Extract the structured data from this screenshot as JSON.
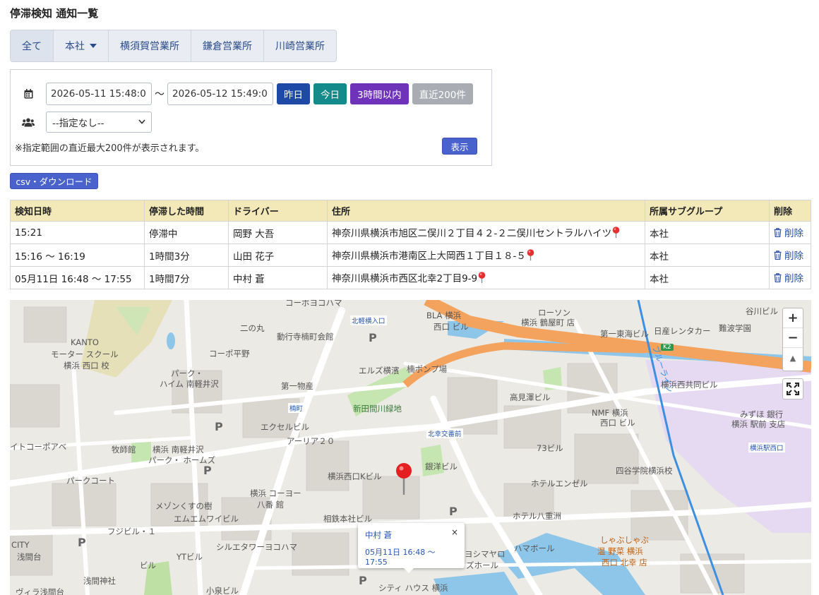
{
  "page": {
    "title": "停滞検知 通知一覧"
  },
  "tabs": [
    {
      "label": "全て",
      "active": true,
      "dropdown": false
    },
    {
      "label": "本社",
      "active": false,
      "dropdown": true
    },
    {
      "label": "横須賀営業所",
      "active": false,
      "dropdown": false
    },
    {
      "label": "鎌倉営業所",
      "active": false,
      "dropdown": false
    },
    {
      "label": "川崎営業所",
      "active": false,
      "dropdown": false
    }
  ],
  "filter": {
    "start_datetime": "2026-05-11 15:48:0",
    "range_separator": "〜",
    "end_datetime": "2026-05-12 15:49:0",
    "quick_buttons": [
      {
        "label": "昨日",
        "color": "#1f49a6"
      },
      {
        "label": "今日",
        "color": "#148a8a"
      },
      {
        "label": "3時間以内",
        "color": "#6e33b8"
      },
      {
        "label": "直近200件",
        "color": "#a9acb3"
      }
    ],
    "group_select_value": "--指定なし--",
    "note": "※指定範囲の直近最大200件が表示されます。",
    "show_button": "表示"
  },
  "csv_button": "csv・ダウンロード",
  "table": {
    "headers": [
      "検知日時",
      "停滞した時間",
      "ドライバー",
      "住所",
      "所属サブグループ",
      "削除"
    ],
    "rows": [
      {
        "detected": "15:21",
        "duration": "停滞中",
        "driver": "岡野 大吾",
        "address": "神奈川県横浜市旭区二俣川２丁目４２-２二俣川セントラルハイツ",
        "group": "本社",
        "delete": "削除"
      },
      {
        "detected": "15:16 〜 16:19",
        "duration": "1時間3分",
        "driver": "山田 花子",
        "address": "神奈川県横浜市港南区上大岡西１丁目１８-５",
        "group": "本社",
        "delete": "削除"
      },
      {
        "detected": "05月11日 16:48 〜 17:55",
        "duration": "1時間7分",
        "driver": "中村 蒼",
        "address": "神奈川県横浜市西区北幸2丁目9-9",
        "group": "本社",
        "delete": "削除"
      }
    ]
  },
  "map": {
    "zoom_in": "+",
    "zoom_out": "−",
    "compass": "▲",
    "popup": {
      "driver": "中村 蒼",
      "time": "05月11日 16:48 〜 17:55",
      "close": "×"
    },
    "labels": [
      "KANTO",
      "モーター スクール",
      "横浜 西口 校",
      "二の丸",
      "動行寺楠町会館",
      "コーポ平野",
      "パーク・",
      "ハイム 南軽井沢",
      "第一物産",
      "エクセルビル",
      "アーリア２０",
      "牧師館",
      "横浜 南軽井沢",
      "パーク・ ホームズ",
      "パークコート",
      "メゾンくすの樹",
      "エムエムワイビル",
      "フジビル・１",
      "シルエタワーヨコハマ",
      "YTビル",
      "ビル",
      "浅間台",
      "浅間神社",
      "ヴィラ浅間台",
      "イトコーポアベ",
      "CITY",
      "北軽横入口",
      "エルズ横濱",
      "楠ポンプ場",
      "新田間川緑地",
      "楠町",
      "北幸交番前",
      "横浜西口Kビル",
      "銀洋ビル",
      "横浜 コーヨー",
      "八番 館",
      "相鉄本社ビル",
      "ローソン",
      "横浜 鶴屋町 店",
      "第一東海ビル",
      "日産レンタカー",
      "難波学園",
      "谷川ビル",
      "BLA 横浜",
      "西口 ビル",
      "高見澤ビル",
      "NMF 横浜",
      "西口 ビル",
      "73ビル",
      "四谷学院横浜校",
      "ホテルエンゼル",
      "ホテル八重洲",
      "ハマボール",
      "ヨシマヤロ",
      "ズホール",
      "しゃぶしゃぶ",
      "温 野菜 横浜",
      "西口 北幸 店",
      "横浜西共同ビル",
      "みずほ 銀行",
      "横浜 駅前 支店",
      "横浜駅西口",
      "シティ ハウス 横浜",
      "小泉ビル",
      "コーポヨコハマ",
      "ブルーライン",
      "K2"
    ]
  }
}
